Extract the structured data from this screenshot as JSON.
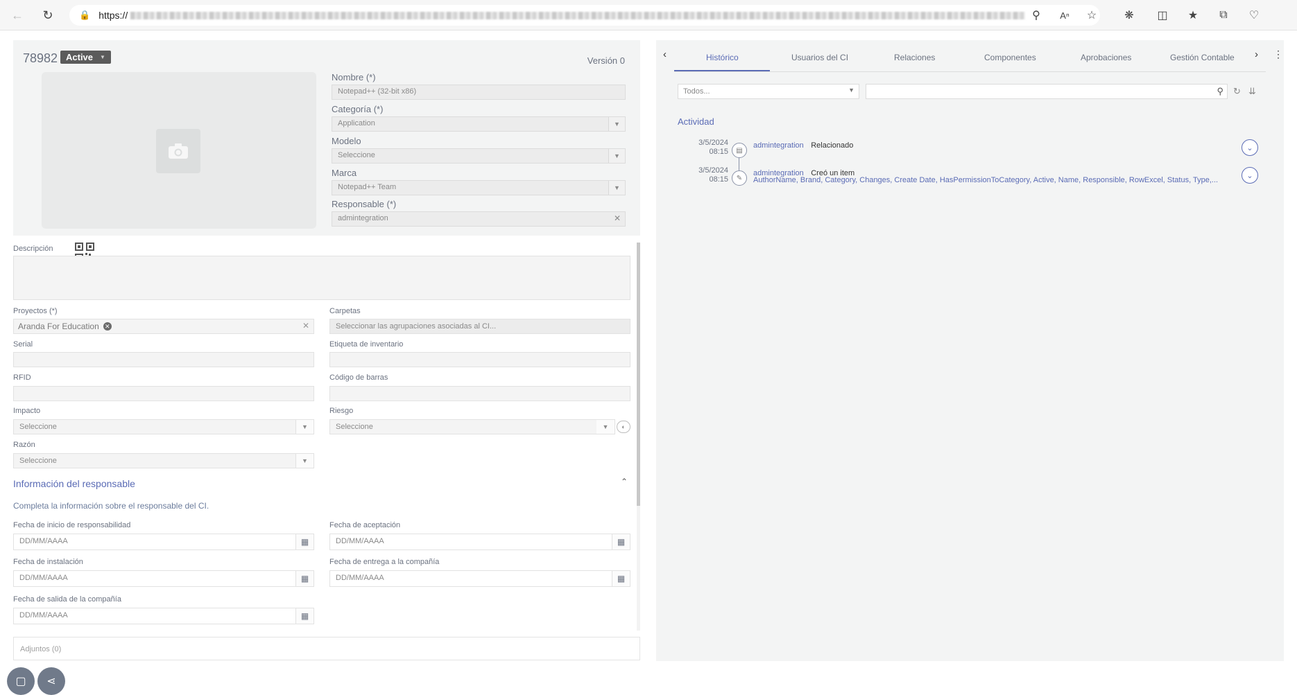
{
  "browser": {
    "url_prefix": "https://",
    "nav_icons": [
      "back-icon",
      "refresh-icon",
      "lock-icon"
    ],
    "toolbar_icons": [
      "zoom-icon",
      "read-aloud-icon",
      "favorite-star-icon",
      "extensions-icon",
      "split-screen-icon",
      "favorites-icon",
      "collections-icon",
      "browser-essentials-icon"
    ]
  },
  "ci": {
    "id": "78982",
    "status": "Active",
    "version": "Versión 0"
  },
  "header_fields": {
    "name_label": "Nombre (*)",
    "name_value": "Notepad++ (32-bit x86)",
    "category_label": "Categoría (*)",
    "category_value": "Application",
    "model_label": "Modelo",
    "model_value": "Seleccione",
    "brand_label": "Marca",
    "brand_value": "Notepad++ Team",
    "responsible_label": "Responsable (*)",
    "responsible_value": "admintegration"
  },
  "form": {
    "description_label": "Descripción",
    "projects_label": "Proyectos (*)",
    "project_chip": "Aranda For Education",
    "folders_label": "Carpetas",
    "folders_placeholder": "Seleccionar las agrupaciones asociadas al CI...",
    "serial_label": "Serial",
    "inventory_label": "Etiqueta de inventario",
    "rfid_label": "RFID",
    "barcode_label": "Código de barras",
    "impact_label": "Impacto",
    "impact_value": "Seleccione",
    "risk_label": "Riesgo",
    "risk_value": "Seleccione",
    "reason_label": "Razón",
    "reason_value": "Seleccione"
  },
  "responsible_section": {
    "title": "Información del responsable",
    "subtitle": "Completa la información sobre el responsable del CI.",
    "start_date_label": "Fecha de inicio de responsabilidad",
    "acceptance_date_label": "Fecha de aceptación",
    "install_date_label": "Fecha de instalación",
    "delivery_date_label": "Fecha de entrega a la compañía",
    "exit_date_label": "Fecha de salida de la compañía",
    "date_placeholder": "DD/MM/AAAA"
  },
  "attachments": "Adjuntos (0)",
  "tabs": [
    "Histórico",
    "Usuarios del CI",
    "Relaciones",
    "Componentes",
    "Aprobaciones",
    "Gestión Contable"
  ],
  "history": {
    "filter_value": "Todos...",
    "activity_title": "Actividad",
    "entries": [
      {
        "date": "3/5/2024",
        "time": "08:15",
        "user": "admintegration",
        "action": "Relacionado",
        "detail": ""
      },
      {
        "date": "3/5/2024",
        "time": "08:15",
        "user": "admintegration",
        "action": "Creó un item",
        "detail": "AuthorName, Brand, Category, Changes, Create Date, HasPermissionToCategory, Active, Name, Responsible, RowExcel, Status, Type,..."
      }
    ]
  }
}
